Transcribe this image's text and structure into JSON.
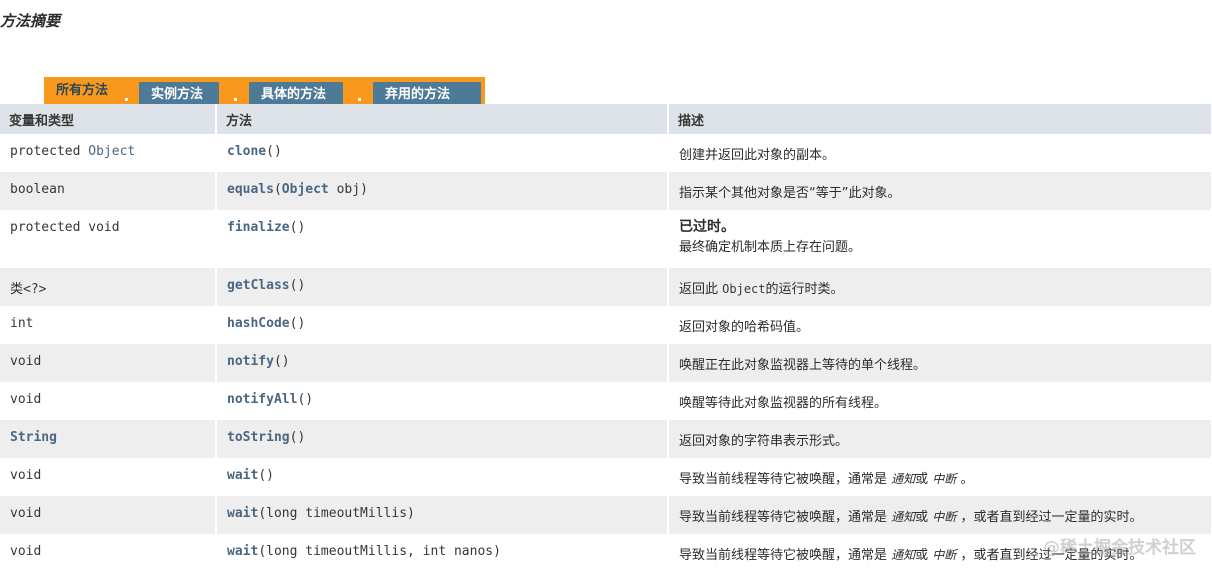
{
  "title": "方法摘要",
  "tabs": {
    "all": "所有方法",
    "instance": "实例方法",
    "concrete": "具体的方法",
    "deprecated": "弃用的方法"
  },
  "headers": {
    "type": "变量和类型",
    "method": "方法",
    "desc": "描述"
  },
  "rows": {
    "r0": {
      "mod": "protected ",
      "type_link": "Object",
      "method": "clone",
      "params": "()",
      "desc": "创建并返回此对象的副本。"
    },
    "r1": {
      "type": "boolean",
      "method": "equals",
      "params_open": "(",
      "param_link": "Object",
      "params_rest": " obj)",
      "desc": "指示某个其他对象是否“等于”此对象。"
    },
    "r2": {
      "type": "protected void",
      "method": "finalize",
      "params": "()",
      "dep": "已过时。",
      "desc": "最终确定机制本质上存在问题。"
    },
    "r3": {
      "type_link": "类",
      "type_rest": "<?>",
      "method": "getClass",
      "params": "()",
      "desc_a": "返回此 ",
      "desc_code": "Object",
      "desc_b": "的运行时类。"
    },
    "r4": {
      "type": "int",
      "method": "hashCode",
      "params": "()",
      "desc": "返回对象的哈希码值。"
    },
    "r5": {
      "type": "void",
      "method": "notify",
      "params": "()",
      "desc": "唤醒正在此对象监视器上等待的单个线程。"
    },
    "r6": {
      "type": "void",
      "method": "notifyAll",
      "params": "()",
      "desc": "唤醒等待此对象监视器的所有线程。"
    },
    "r7": {
      "type_link": "String",
      "method": "toString",
      "params": "()",
      "desc": "返回对象的字符串表示形式。"
    },
    "r8": {
      "type": "void",
      "method": "wait",
      "params": "()",
      "desc_a": "导致当前线程等待它被唤醒，通常是 ",
      "em1": "通知",
      "mid": "或 ",
      "em2": "中断",
      "desc_b": " 。"
    },
    "r9": {
      "type": "void",
      "method": "wait",
      "params": "(long timeoutMillis)",
      "desc_a": "导致当前线程等待它被唤醒，通常是 ",
      "em1": "通知",
      "mid": "或 ",
      "em2": "中断",
      "desc_b": " ，或者直到经过一定量的实时。"
    },
    "r10": {
      "type": "void",
      "method": "wait",
      "params": "(long timeoutMillis, int nanos)",
      "desc_a": "导致当前线程等待它被唤醒，通常是 ",
      "em1": "通知",
      "mid": "或 ",
      "em2": "中断",
      "desc_b": " ，或者直到经过一定量的实时。"
    }
  },
  "watermark": "@稀土掘金技术社区"
}
